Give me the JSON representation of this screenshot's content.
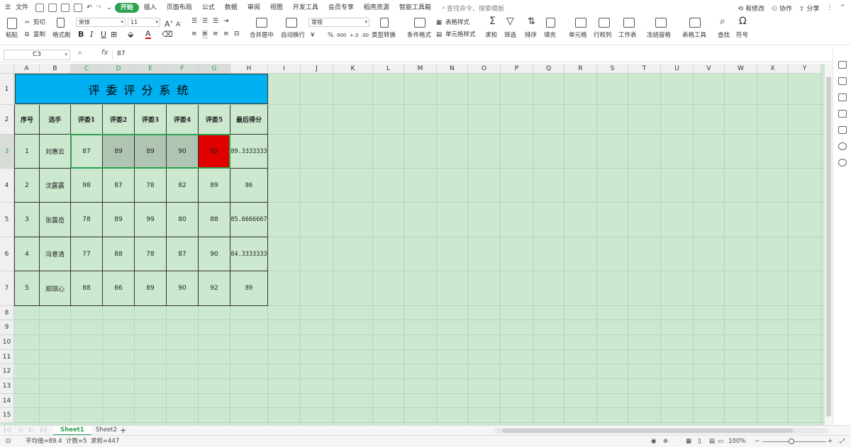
{
  "menu": {
    "file": "文件",
    "tabs": [
      "开始",
      "插入",
      "页面布局",
      "公式",
      "数据",
      "审阅",
      "视图",
      "开发工具",
      "会员专享",
      "稻壳资源",
      "智能工具箱"
    ],
    "active_tab": "开始",
    "search": "查找命令、搜索模板",
    "right": [
      "有修改",
      "协作",
      "分享"
    ]
  },
  "ribbon": {
    "paste": "粘贴",
    "cut": "剪切",
    "copy": "复制",
    "format_painter": "格式刷",
    "font_name": "宋体",
    "font_size": "11",
    "bold": "B",
    "italic": "I",
    "underline": "U",
    "font_color_icon": "A",
    "merge": "合并居中",
    "wrap": "自动换行",
    "number_format": "常规",
    "currency": "¥",
    "percent": "%",
    "thousands": "000",
    "inc_decimal": "+.0",
    "dec_decimal": ".00",
    "type_convert": "类型转换",
    "conditional": "条件格式",
    "table_style": "表格样式",
    "cell_style": "单元格样式",
    "sum": "求和",
    "filter": "筛选",
    "sort": "排序",
    "fill": "填充",
    "cells": "单元格",
    "rows_cols": "行和列",
    "worksheet": "工作表",
    "freeze": "冻结窗格",
    "table_tools": "表格工具",
    "find": "查找",
    "symbol": "符号"
  },
  "formula_bar": {
    "name_box": "C3",
    "fx": "fx",
    "value": "87"
  },
  "columns": [
    "A",
    "B",
    "C",
    "D",
    "E",
    "F",
    "G",
    "H",
    "I",
    "J",
    "K",
    "L",
    "M",
    "N",
    "O",
    "P",
    "Q",
    "R",
    "S",
    "T",
    "U",
    "V",
    "W",
    "X",
    "Y"
  ],
  "rows": [
    "1",
    "2",
    "3",
    "4",
    "5",
    "6",
    "7",
    "8",
    "9",
    "10",
    "11",
    "12",
    "13",
    "14",
    "15"
  ],
  "sheet": {
    "title": "评委评分系统",
    "headers": [
      "序号",
      "选手",
      "评委1",
      "评委2",
      "评委3",
      "评委4",
      "评委5",
      "最后得分"
    ],
    "data": [
      [
        "1",
        "刘惠云",
        "87",
        "89",
        "89",
        "90",
        "92",
        "89.3333333"
      ],
      [
        "2",
        "沈露露",
        "98",
        "87",
        "78",
        "82",
        "89",
        "86"
      ],
      [
        "3",
        "张震岳",
        "78",
        "89",
        "99",
        "80",
        "88",
        "85.6666667"
      ],
      [
        "4",
        "冯意清",
        "77",
        "88",
        "78",
        "87",
        "90",
        "84.3333333"
      ],
      [
        "5",
        "郑琪心",
        "88",
        "86",
        "89",
        "90",
        "92",
        "89"
      ]
    ]
  },
  "colors": {
    "title_fill": "#00b0f0",
    "red_fill": "#e00000",
    "selection_fill": "#afc4b1",
    "accent": "#2fa152"
  },
  "tabs": {
    "sheets": [
      "Sheet1",
      "Sheet2"
    ],
    "active": "Sheet1",
    "add": "+"
  },
  "status": {
    "summary": "平均值=89.4  计数=5  求和=447",
    "zoom": "100%"
  }
}
